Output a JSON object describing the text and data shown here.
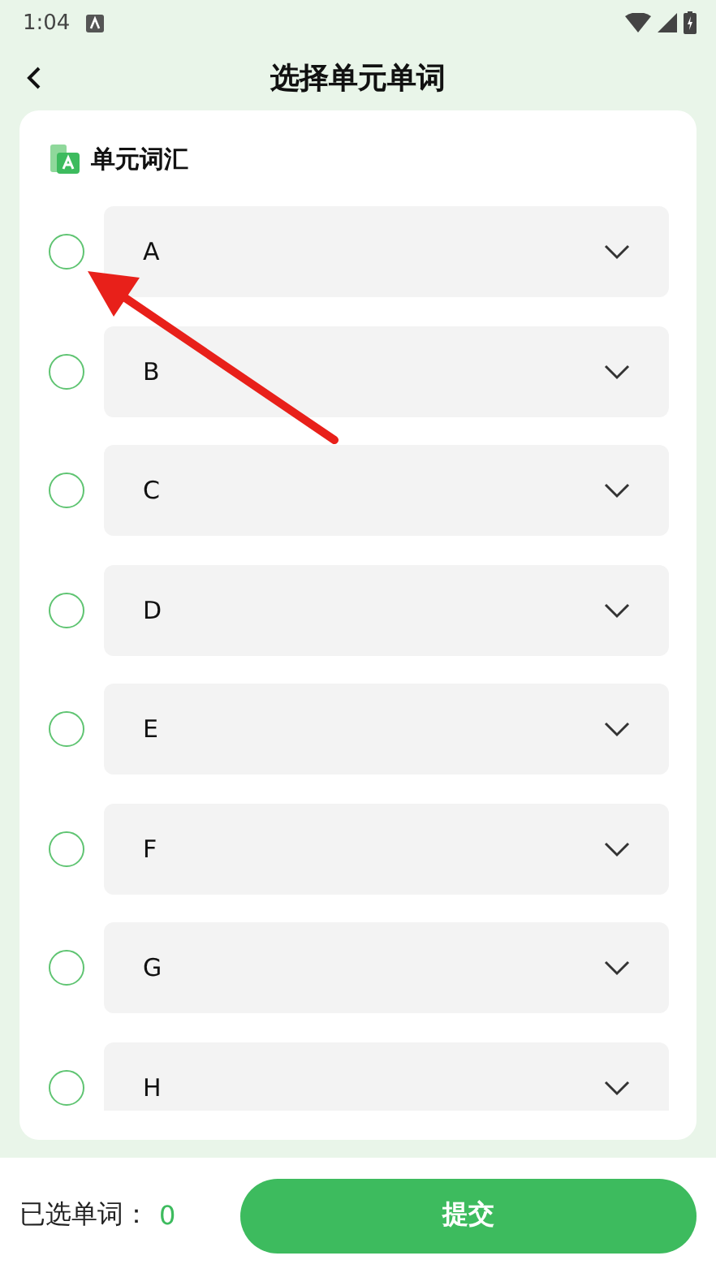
{
  "status_bar": {
    "time": "1:04"
  },
  "header": {
    "title": "选择单元单词"
  },
  "card": {
    "title": "单元词汇",
    "units": [
      {
        "label": "A",
        "selected": false
      },
      {
        "label": "B",
        "selected": false
      },
      {
        "label": "C",
        "selected": false
      },
      {
        "label": "D",
        "selected": false
      },
      {
        "label": "E",
        "selected": false
      },
      {
        "label": "F",
        "selected": false
      },
      {
        "label": "G",
        "selected": false
      },
      {
        "label": "H",
        "selected": false
      }
    ]
  },
  "footer": {
    "selected_label": "已选单词：",
    "selected_count": "0",
    "submit": "提交"
  }
}
